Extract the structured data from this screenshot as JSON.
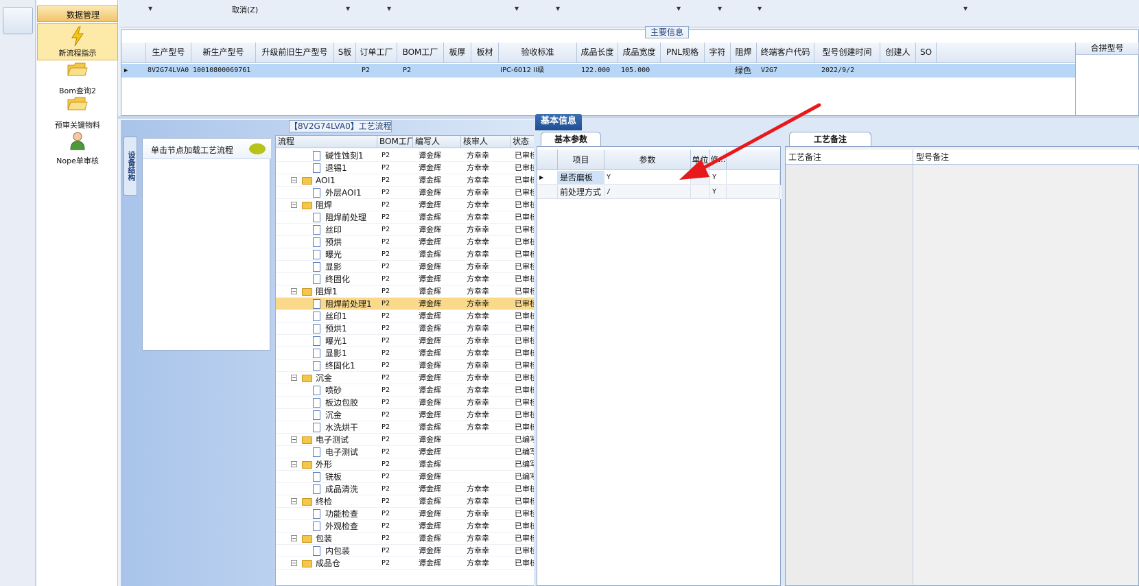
{
  "nav": {
    "section_title": "数据管理",
    "items": [
      {
        "label": "新流程指示",
        "icon": "lightning-icon",
        "active": true
      },
      {
        "label": "Bom查询2",
        "icon": "folder-icon"
      },
      {
        "label": "预审关键物料",
        "icon": "folder-icon"
      },
      {
        "label": "Nope单审核",
        "icon": "user-icon"
      }
    ]
  },
  "toolbar": {
    "cancel_label": "取消(Z)"
  },
  "main_info": {
    "title": "主要信息",
    "columns": [
      "生产型号",
      "新生产型号",
      "升级前旧生产型号",
      "S板",
      "订单工厂",
      "BOM工厂",
      "板厚",
      "板材",
      "验收标准",
      "成品长度",
      "成品宽度",
      "PNL规格",
      "字符",
      "阻焊",
      "终端客户代码",
      "型号创建时间",
      "创建人",
      "SO"
    ],
    "row": [
      "8V2G74LVA0",
      "10010800069761",
      "",
      "",
      "P2",
      "P2",
      "",
      "",
      "IPC-6012 II级",
      "122.000",
      "105.000",
      "",
      "",
      "绿色",
      "V2G7",
      "2022/9/2",
      "",
      ""
    ],
    "merge_title": "合拼型号"
  },
  "flow": {
    "title": "【8V2G74LVA0】工艺流程",
    "side_tab": "设备结构",
    "load_label": "单击节点加载工艺流程",
    "columns": [
      "流程",
      "BOM工厂",
      "编写人",
      "核审人",
      "状态"
    ],
    "rows": [
      {
        "name": "碱性蚀刻1",
        "level": 2,
        "bom": "P2",
        "writer": "谭金辉",
        "reviewer": "方幸幸",
        "status": "已审核"
      },
      {
        "name": "退锡1",
        "level": 2,
        "bom": "P2",
        "writer": "谭金辉",
        "reviewer": "方幸幸",
        "status": "已审核"
      },
      {
        "name": "AOI1",
        "level": 1,
        "bom": "P2",
        "writer": "谭金辉",
        "reviewer": "方幸幸",
        "status": "已审核"
      },
      {
        "name": "外层AOI1",
        "level": 2,
        "bom": "P2",
        "writer": "谭金辉",
        "reviewer": "方幸幸",
        "status": "已审核"
      },
      {
        "name": "阻焊",
        "level": 1,
        "bom": "P2",
        "writer": "谭金辉",
        "reviewer": "方幸幸",
        "status": "已审核"
      },
      {
        "name": "阻焊前处理",
        "level": 2,
        "bom": "P2",
        "writer": "谭金辉",
        "reviewer": "方幸幸",
        "status": "已审核"
      },
      {
        "name": "丝印",
        "level": 2,
        "bom": "P2",
        "writer": "谭金辉",
        "reviewer": "方幸幸",
        "status": "已审核"
      },
      {
        "name": "预烘",
        "level": 2,
        "bom": "P2",
        "writer": "谭金辉",
        "reviewer": "方幸幸",
        "status": "已审核"
      },
      {
        "name": "曝光",
        "level": 2,
        "bom": "P2",
        "writer": "谭金辉",
        "reviewer": "方幸幸",
        "status": "已审核"
      },
      {
        "name": "显影",
        "level": 2,
        "bom": "P2",
        "writer": "谭金辉",
        "reviewer": "方幸幸",
        "status": "已审核"
      },
      {
        "name": "终固化",
        "level": 2,
        "bom": "P2",
        "writer": "谭金辉",
        "reviewer": "方幸幸",
        "status": "已审核"
      },
      {
        "name": "阻焊1",
        "level": 1,
        "bom": "P2",
        "writer": "谭金辉",
        "reviewer": "方幸幸",
        "status": "已审核"
      },
      {
        "name": "阻焊前处理1",
        "level": 2,
        "bom": "P2",
        "writer": "谭金辉",
        "reviewer": "方幸幸",
        "status": "已审核",
        "selected": true
      },
      {
        "name": "丝印1",
        "level": 2,
        "bom": "P2",
        "writer": "谭金辉",
        "reviewer": "方幸幸",
        "status": "已审核"
      },
      {
        "name": "预烘1",
        "level": 2,
        "bom": "P2",
        "writer": "谭金辉",
        "reviewer": "方幸幸",
        "status": "已审核"
      },
      {
        "name": "曝光1",
        "level": 2,
        "bom": "P2",
        "writer": "谭金辉",
        "reviewer": "方幸幸",
        "status": "已审核"
      },
      {
        "name": "显影1",
        "level": 2,
        "bom": "P2",
        "writer": "谭金辉",
        "reviewer": "方幸幸",
        "status": "已审核"
      },
      {
        "name": "终固化1",
        "level": 2,
        "bom": "P2",
        "writer": "谭金辉",
        "reviewer": "方幸幸",
        "status": "已审核"
      },
      {
        "name": "沉金",
        "level": 1,
        "bom": "P2",
        "writer": "谭金辉",
        "reviewer": "方幸幸",
        "status": "已审核"
      },
      {
        "name": "喷砂",
        "level": 2,
        "bom": "P2",
        "writer": "谭金辉",
        "reviewer": "方幸幸",
        "status": "已审核"
      },
      {
        "name": "板边包胶",
        "level": 2,
        "bom": "P2",
        "writer": "谭金辉",
        "reviewer": "方幸幸",
        "status": "已审核"
      },
      {
        "name": "沉金",
        "level": 2,
        "bom": "P2",
        "writer": "谭金辉",
        "reviewer": "方幸幸",
        "status": "已审核"
      },
      {
        "name": "水洗烘干",
        "level": 2,
        "bom": "P2",
        "writer": "谭金辉",
        "reviewer": "方幸幸",
        "status": "已审核"
      },
      {
        "name": "电子测试",
        "level": 1,
        "bom": "P2",
        "writer": "谭金辉",
        "reviewer": "",
        "status": "已编写"
      },
      {
        "name": "电子测试",
        "level": 2,
        "bom": "P2",
        "writer": "谭金辉",
        "reviewer": "",
        "status": "已编写"
      },
      {
        "name": "外形",
        "level": 1,
        "bom": "P2",
        "writer": "谭金辉",
        "reviewer": "",
        "status": "已编写"
      },
      {
        "name": "铣板",
        "level": 2,
        "bom": "P2",
        "writer": "谭金辉",
        "reviewer": "",
        "status": "已编写"
      },
      {
        "name": "成品清洗",
        "level": 2,
        "bom": "P2",
        "writer": "谭金辉",
        "reviewer": "方幸幸",
        "status": "已审核"
      },
      {
        "name": "终检",
        "level": 1,
        "bom": "P2",
        "writer": "谭金辉",
        "reviewer": "方幸幸",
        "status": "已审核"
      },
      {
        "name": "功能检查",
        "level": 2,
        "bom": "P2",
        "writer": "谭金辉",
        "reviewer": "方幸幸",
        "status": "已审核"
      },
      {
        "name": "外观检查",
        "level": 2,
        "bom": "P2",
        "writer": "谭金辉",
        "reviewer": "方幸幸",
        "status": "已审核"
      },
      {
        "name": "包装",
        "level": 1,
        "bom": "P2",
        "writer": "谭金辉",
        "reviewer": "方幸幸",
        "status": "已审核"
      },
      {
        "name": "内包装",
        "level": 2,
        "bom": "P2",
        "writer": "谭金辉",
        "reviewer": "方幸幸",
        "status": "已审核"
      },
      {
        "name": "成品仓",
        "level": 1,
        "bom": "P2",
        "writer": "谭金辉",
        "reviewer": "方幸幸",
        "status": "已审核"
      }
    ]
  },
  "basic": {
    "tab": "基本信息",
    "param_tab": "基本参数",
    "columns": [
      "项目",
      "参数",
      "单位",
      "修..."
    ],
    "rows": [
      {
        "item": "是否磨板",
        "value": "Y",
        "unit": "",
        "mod": "Y"
      },
      {
        "item": "前处理方式",
        "value": "/",
        "unit": "",
        "mod": "Y"
      }
    ]
  },
  "notes": {
    "tab": "工艺备注",
    "columns": [
      "工艺备注",
      "型号备注"
    ]
  },
  "colors": {
    "accent": "#1f4f94",
    "selected_row": "#b8d6f6",
    "tree_selected": "#fbd98a",
    "arrow": "#e8191b"
  }
}
